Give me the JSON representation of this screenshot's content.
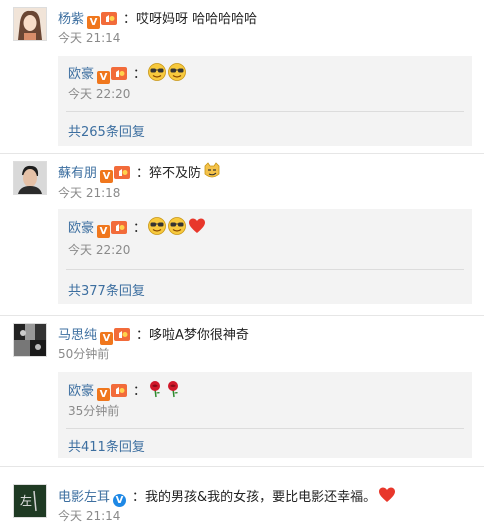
{
  "comments": [
    {
      "author": "杨紫",
      "text": "：哎呀妈呀 哈哈哈哈哈",
      "time": "今天 21:14",
      "reply": {
        "author": "欧豪",
        "text": "：",
        "emojis": [
          "cool-face-emoji",
          "cool-face-emoji"
        ],
        "time": "今天 22:20",
        "more": "共265条回复"
      }
    },
    {
      "author": "蘇有朋",
      "text": "：猝不及防",
      "emojis": [
        "smirk-cat-emoji"
      ],
      "time": "今天 21:18",
      "reply": {
        "author": "欧豪",
        "text": "：",
        "emojis": [
          "cool-face-emoji",
          "cool-face-emoji",
          "heart-emoji"
        ],
        "time": "今天 22:20",
        "more": "共377条回复"
      }
    },
    {
      "author": "马思纯",
      "text": "：哆啦A梦你很神奇",
      "time": "50分钟前",
      "reply": {
        "author": "欧豪",
        "text": "：",
        "emojis": [
          "rose-emoji",
          "rose-emoji"
        ],
        "time": "35分钟前",
        "more": "共411条回复"
      }
    },
    {
      "author": "电影左耳",
      "text": "：我的男孩&我的女孩，要比电影还幸福。",
      "emojis": [
        "heart-emoji"
      ],
      "time": "今天 21:14"
    }
  ],
  "badges": {
    "vip_v": "V"
  },
  "colors": {
    "name": "#3d6fa0",
    "verified_orange": "#f0771d",
    "verified_blue": "#1e88e5",
    "reply_bg": "#f3f3f3"
  }
}
